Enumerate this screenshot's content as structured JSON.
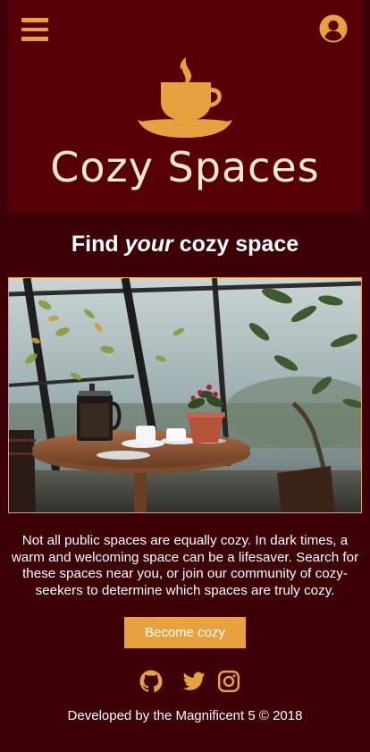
{
  "colors": {
    "page_background": "#3d0007",
    "hero_background": "#560006",
    "accent": "#e8a13f",
    "logo_text": "#f8e7d0",
    "text": "#ffffff"
  },
  "header": {
    "menu_icon": "hamburger-menu-icon",
    "account_icon": "user-circle-icon"
  },
  "brand": {
    "logo_icon": "steaming-coffee-cup-icon",
    "name": "Cozy Spaces"
  },
  "hero": {
    "headline_before": "Find ",
    "headline_emphasis": "your",
    "headline_after": " cozy space"
  },
  "photo": {
    "subject": "cafe table by greenhouse window with french press, teacups and potted plant"
  },
  "intro": {
    "text": "Not all public spaces are equally cozy. In dark times, a warm and welcoming space can be a lifesaver. Search for these spaces near you, or join our community of cozy-seekers to determine which spaces are truly cozy."
  },
  "cta": {
    "label": "Become cozy"
  },
  "socials": [
    {
      "icon": "github-icon"
    },
    {
      "icon": "twitter-icon"
    },
    {
      "icon": "instagram-icon"
    }
  ],
  "footer": {
    "credit": "Developed by the Magnificent 5 © 2018"
  }
}
